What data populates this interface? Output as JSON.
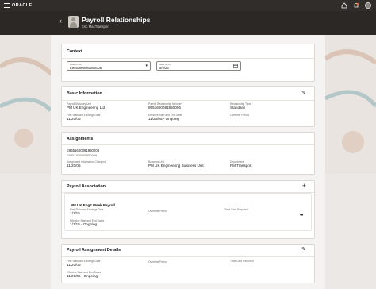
{
  "topbar": {
    "brand": "ORACLE",
    "icons": [
      "home-icon",
      "notifications-icon",
      "user-avatar"
    ]
  },
  "header": {
    "back_icon": "chevron-left-icon",
    "title": "Payroll Relationships",
    "subtitle": "Eric MacTransport"
  },
  "context": {
    "title": "Context",
    "assignment": {
      "label": "Assignment",
      "value": "E9551600081850006"
    },
    "date": {
      "label": "Date as of",
      "value": "5/9/23"
    }
  },
  "basic": {
    "title": "Basic Information",
    "edit_icon": "edit-icon",
    "fields": [
      {
        "label": "Payroll Statutory Unit",
        "value": "PM UK Engineering Ltd"
      },
      {
        "label": "Payroll Relationship Number",
        "value": "9551600081850006"
      },
      {
        "label": "Relationship Type",
        "value": "Standard"
      },
      {
        "label": "First Standard Earnings Date",
        "value": "11/20/05"
      },
      {
        "label": "Effective Start and End Dates",
        "value": "11/20/05 - Ongoing"
      },
      {
        "label": "Overtime Period",
        "value": ""
      }
    ]
  },
  "assignments": {
    "title": "Assignments",
    "number": "E9551600081850006",
    "number2": "E9551600081850006",
    "fields": [
      {
        "label": "Assignment Information Changed",
        "value": "11/20/05"
      },
      {
        "label": "Business Unit",
        "value": "PM UK Engineering Business Unit"
      },
      {
        "label": "Department",
        "value": "PM Transport"
      }
    ]
  },
  "payroll_association": {
    "title": "Payroll Association",
    "add_icon": "plus-icon",
    "item": {
      "name": "PM UK Eng2 Week Payroll",
      "fields": [
        {
          "label": "First Standard Earnings Date",
          "value": "1/1/15"
        },
        {
          "label": "Overtime Period",
          "value": ""
        },
        {
          "label": "Time Card Required",
          "value": ""
        },
        {
          "label": "Effective Start and End Dates",
          "value": "1/1/15 - Ongoing"
        }
      ],
      "more_icon": "more-actions-icon"
    }
  },
  "assignment_details": {
    "title": "Payroll Assignment Details",
    "edit_icon": "edit-icon",
    "fields": [
      {
        "label": "First Standard Earnings Date",
        "value": "11/20/05"
      },
      {
        "label": "Overtime Period",
        "value": ""
      },
      {
        "label": "Time Card Required",
        "value": ""
      },
      {
        "label": "Effective Start and End Dates",
        "value": "11/20/05 - Ongoing"
      }
    ]
  }
}
